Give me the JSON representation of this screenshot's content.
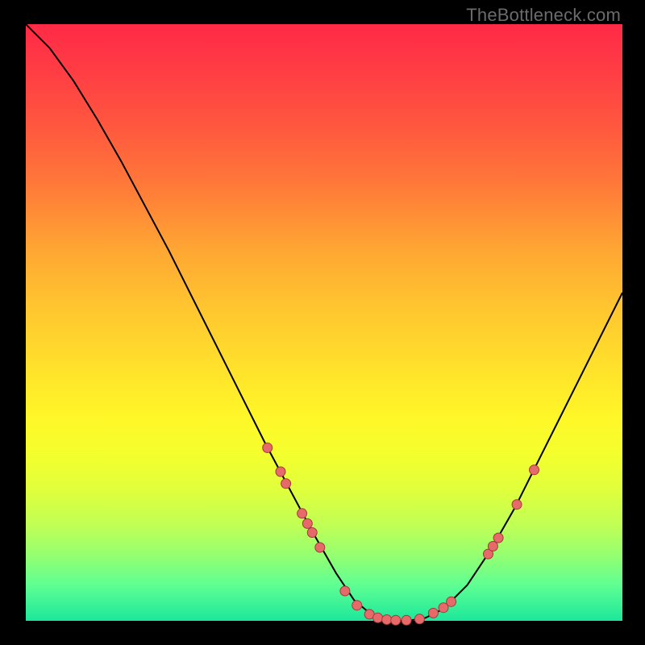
{
  "watermark": "TheBottleneck.com",
  "chart_data": {
    "type": "line",
    "title": "",
    "xlabel": "",
    "ylabel": "",
    "xlim": [
      0,
      100
    ],
    "ylim": [
      0,
      100
    ],
    "series": [
      {
        "name": "curve",
        "x": [
          0,
          4,
          8,
          12,
          16,
          20,
          24,
          28,
          32,
          36,
          40,
          44,
          48,
          52,
          55,
          58,
          61,
          64,
          67,
          70,
          74,
          78,
          82,
          86,
          90,
          94,
          98,
          100
        ],
        "y": [
          100,
          96,
          90.5,
          84,
          77,
          69.5,
          62,
          54,
          46,
          38,
          30,
          22.5,
          15,
          8,
          3.5,
          1,
          0,
          0,
          0.5,
          2,
          6,
          12,
          19,
          27,
          35,
          43,
          51,
          55
        ]
      }
    ],
    "markers": [
      {
        "x": 40.5,
        "y": 29
      },
      {
        "x": 42.7,
        "y": 25
      },
      {
        "x": 43.6,
        "y": 23
      },
      {
        "x": 46.3,
        "y": 18
      },
      {
        "x": 47.2,
        "y": 16.3
      },
      {
        "x": 48,
        "y": 14.8
      },
      {
        "x": 49.3,
        "y": 12.3
      },
      {
        "x": 53.5,
        "y": 5
      },
      {
        "x": 55.5,
        "y": 2.6
      },
      {
        "x": 57.6,
        "y": 1.1
      },
      {
        "x": 59,
        "y": 0.5
      },
      {
        "x": 60.5,
        "y": 0.2
      },
      {
        "x": 62,
        "y": 0.1
      },
      {
        "x": 63.8,
        "y": 0.1
      },
      {
        "x": 66,
        "y": 0.3
      },
      {
        "x": 68.3,
        "y": 1.3
      },
      {
        "x": 70,
        "y": 2.2
      },
      {
        "x": 71.3,
        "y": 3.2
      },
      {
        "x": 77.5,
        "y": 11.2
      },
      {
        "x": 78.3,
        "y": 12.5
      },
      {
        "x": 79.2,
        "y": 13.9
      },
      {
        "x": 82.3,
        "y": 19.5
      },
      {
        "x": 85.2,
        "y": 25.3
      }
    ],
    "marker_style": {
      "fill": "#e66a6a",
      "stroke": "#a33a3a",
      "r": 6
    }
  }
}
